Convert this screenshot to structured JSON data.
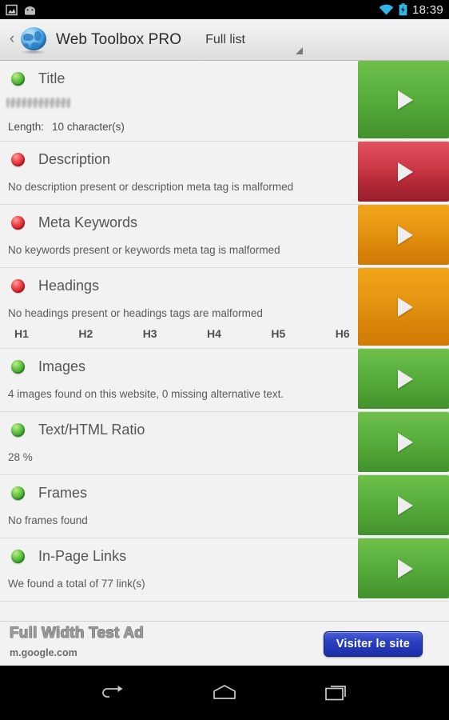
{
  "status_bar": {
    "icons": [
      "screenshot-icon",
      "android-head-icon",
      "wifi-icon",
      "battery-charging-icon"
    ],
    "clock": "18:39",
    "wifi_color": "#33b5e5",
    "battery_color": "#33b5e5"
  },
  "action_bar": {
    "back_label": "‹",
    "app_icon": "globe-icon",
    "title": "Web Toolbox PRO",
    "spinner_value": "Full list"
  },
  "colors": {
    "status_ok": "#4aa82a",
    "status_error": "#cf1f28",
    "button_green": "#58ae3c",
    "button_red": "#cc3744",
    "button_orange": "#e49412",
    "ad_button_blue": "#2b3fc0",
    "list_background": "#f2f2f2"
  },
  "list": {
    "items": [
      {
        "name": "title",
        "title": "Title",
        "status": "ok",
        "button_color": "green",
        "value_blurred": true,
        "sub_label": "Length:",
        "sub_value": "10 character(s)"
      },
      {
        "name": "description",
        "title": "Description",
        "status": "error",
        "button_color": "red",
        "description": "No description present or description meta tag is malformed"
      },
      {
        "name": "meta-keywords",
        "title": "Meta Keywords",
        "status": "error",
        "button_color": "orange",
        "description": "No keywords present or keywords meta tag is malformed"
      },
      {
        "name": "headings",
        "title": "Headings",
        "status": "error",
        "button_color": "orange",
        "description": "No headings present or headings tags are malformed",
        "heading_levels": [
          "H1",
          "H2",
          "H3",
          "H4",
          "H5",
          "H6"
        ]
      },
      {
        "name": "images",
        "title": "Images",
        "status": "ok",
        "button_color": "green",
        "description": "4 images found on this website, 0 missing alternative text."
      },
      {
        "name": "text-html-ratio",
        "title": "Text/HTML Ratio",
        "status": "ok",
        "button_color": "green",
        "description": "28 %"
      },
      {
        "name": "frames",
        "title": "Frames",
        "status": "ok",
        "button_color": "green",
        "description": "No frames found"
      },
      {
        "name": "in-page-links",
        "title": "In-Page Links",
        "status": "ok",
        "button_color": "green",
        "description": "We found a total of 77 link(s)"
      }
    ]
  },
  "ad": {
    "title": "Full Width Test Ad",
    "url": "m.google.com",
    "button_label": "Visiter le site"
  },
  "nav_bar": {
    "back": "back-icon",
    "home": "home-icon",
    "recents": "recents-icon"
  }
}
